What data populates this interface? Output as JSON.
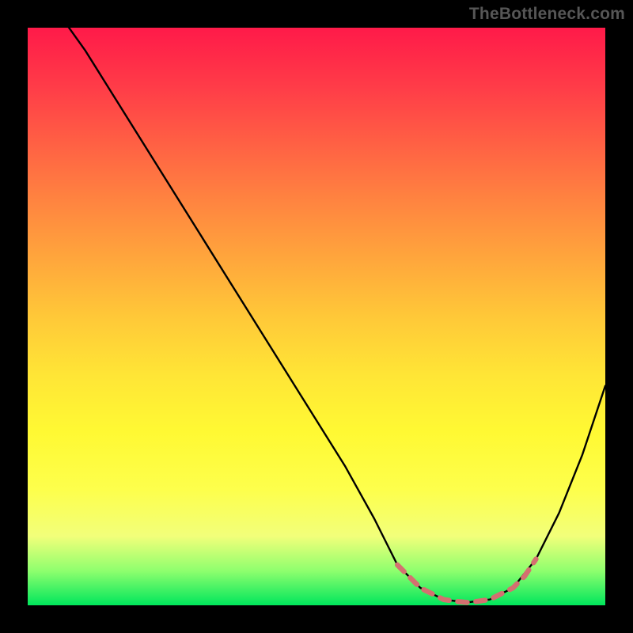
{
  "watermark": "TheBottleneck.com",
  "chart_data": {
    "type": "line",
    "title": "",
    "xlabel": "",
    "ylabel": "",
    "xlim": [
      0,
      100
    ],
    "ylim": [
      0,
      100
    ],
    "series": [
      {
        "name": "bottleneck-curve",
        "color": "#000000",
        "x": [
          5,
          10,
          15,
          20,
          25,
          30,
          35,
          40,
          45,
          50,
          55,
          60,
          64,
          68,
          72,
          76,
          80,
          84,
          88,
          92,
          96,
          100
        ],
        "y": [
          103,
          96,
          88,
          80,
          72,
          64,
          56,
          48,
          40,
          32,
          24,
          15,
          7,
          3,
          1,
          0.5,
          1,
          3,
          8,
          16,
          26,
          38
        ]
      },
      {
        "name": "optimal-band",
        "color": "#d47070",
        "dashed": true,
        "x": [
          64,
          66,
          68,
          70,
          72,
          74,
          76,
          78,
          80,
          82,
          84,
          86,
          88
        ],
        "y": [
          7,
          5,
          3,
          2,
          1,
          0.7,
          0.5,
          0.7,
          1,
          2,
          3,
          5,
          8
        ]
      }
    ]
  }
}
